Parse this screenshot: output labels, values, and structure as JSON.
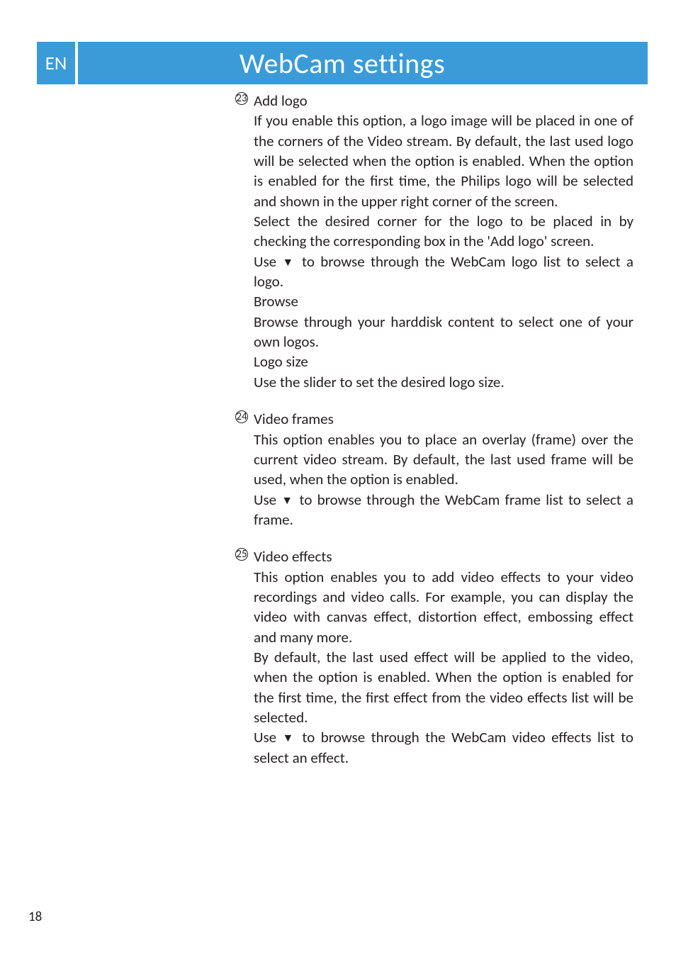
{
  "header": {
    "lang": "EN",
    "title": "WebCam settings"
  },
  "sections": [
    {
      "num": "23",
      "title": "Add logo",
      "paragraphs": [
        {
          "pre": "If you enable this option, a logo image will be placed in one of the corners of the Video stream. By default, the last used logo will be selected when the option is enabled. When the option is enabled for the first time, the Philips logo will be selected and shown in the upper right corner of the screen."
        },
        {
          "pre": "Select the desired corner for the logo to be placed in by checking the corresponding box in the '",
          "bold": "Add logo",
          "post": "' screen."
        },
        {
          "pre": "Use ",
          "arrow": "▼",
          "post": " to browse through the WebCam logo list to select a logo."
        }
      ],
      "subs": [
        {
          "title": "Browse",
          "text": "Browse through your harddisk content to select one of your own logos."
        },
        {
          "title": "Logo size",
          "text": "Use the slider to set the desired logo size."
        }
      ]
    },
    {
      "num": "24",
      "title": "Video frames",
      "paragraphs": [
        {
          "pre": "This option enables you to place an overlay (frame) over the current video stream. By default, the last used frame will be used, when the option is enabled."
        },
        {
          "pre": "Use ",
          "arrow": "▼",
          "post": " to browse through the WebCam frame list to select a frame."
        }
      ],
      "subs": []
    },
    {
      "num": "25",
      "title": "Video effects",
      "paragraphs": [
        {
          "pre": "This option enables you to add video effects to your video recordings and video calls. For example, you can display the video with canvas effect, distortion effect, embossing effect and many more."
        },
        {
          "pre": "By default, the last used effect will be applied to the video, when the option is enabled. When the option is enabled for the first time, the first effect from the video effects list will be selected."
        },
        {
          "pre": "Use ",
          "arrow": "▼",
          "post": " to browse through the WebCam video effects list to select an effect."
        }
      ],
      "subs": []
    }
  ],
  "page": "18"
}
